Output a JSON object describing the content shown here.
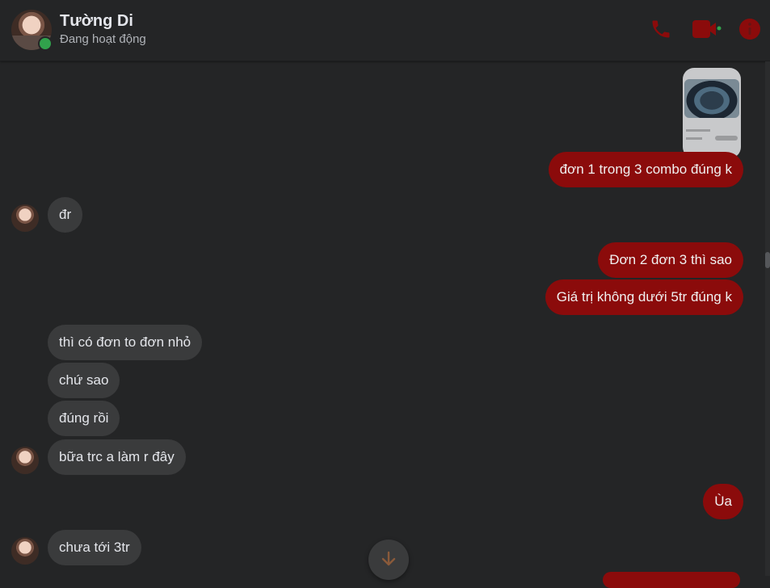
{
  "header": {
    "name": "Tường Di",
    "status": "Đang hoạt động",
    "icons": [
      "phone-icon",
      "video-call-icon",
      "info-icon"
    ],
    "accent_color": "#8b0b0b",
    "online_color": "#31a24c"
  },
  "messages": [
    {
      "side": "out",
      "text": "đơn 1 trong 3 combo đúng k"
    },
    {
      "side": "in",
      "text": "đr"
    },
    {
      "side": "out",
      "text": "Đơn 2 đơn 3 thì sao"
    },
    {
      "side": "out",
      "text": "Giá trị không dưới 5tr đúng k"
    },
    {
      "side": "in",
      "text": "thì có đơn to đơn nhỏ"
    },
    {
      "side": "in",
      "text": "chứ sao"
    },
    {
      "side": "in",
      "text": "đúng rồi"
    },
    {
      "side": "in",
      "text": "bữa trc a làm r đây"
    },
    {
      "side": "out",
      "text": "Ùa"
    },
    {
      "side": "in",
      "text": "chưa tới 3tr"
    }
  ],
  "colors": {
    "background": "#242526",
    "outgoing_bubble": "#8b0b0b",
    "incoming_bubble": "#3a3b3c"
  }
}
